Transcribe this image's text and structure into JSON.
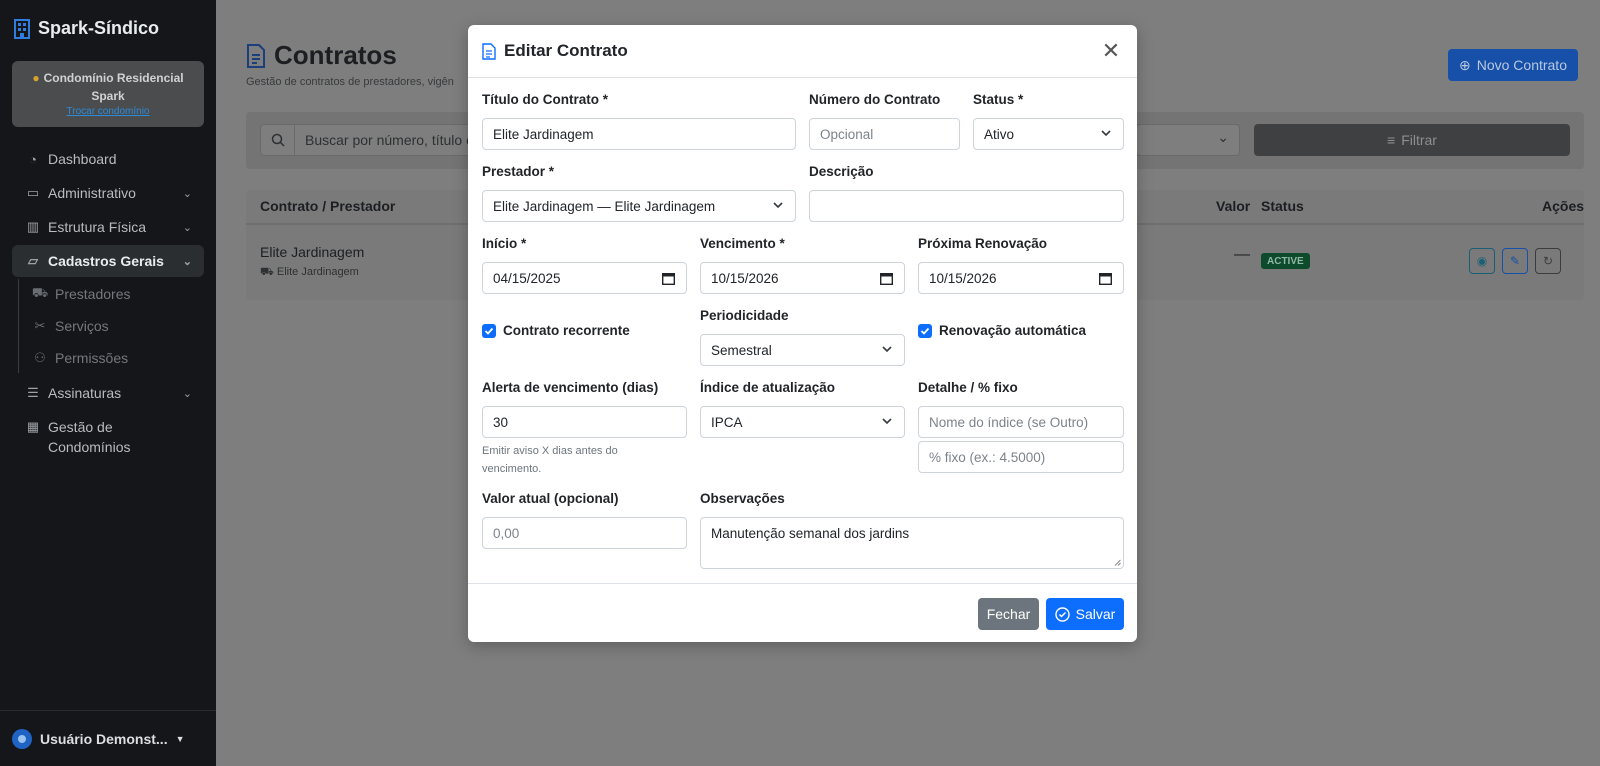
{
  "app": {
    "name": "Spark-Síndico"
  },
  "condo": {
    "name": "Condomínio Residencial Spark",
    "switch_label": "Trocar condomínio"
  },
  "nav": {
    "dashboard": "Dashboard",
    "administrativo": "Administrativo",
    "estrutura": "Estrutura Física",
    "cadastros": "Cadastros Gerais",
    "sub": {
      "prestadores": "Prestadores",
      "servicos": "Serviços",
      "permissoes": "Permissões"
    },
    "assinaturas": "Assinaturas",
    "gestao": "Gestão de Condomínios"
  },
  "user": {
    "name": "Usuário Demonst..."
  },
  "page": {
    "title": "Contratos",
    "subtitle": "Gestão de contratos de prestadores, vigên",
    "new_button": "Novo Contrato",
    "search_placeholder": "Buscar por número, título o",
    "filter_button": "Filtrar",
    "table": {
      "headers": {
        "contract": "Contrato / Prestador",
        "value": "Valor",
        "status": "Status",
        "actions": "Ações"
      },
      "rows": [
        {
          "title": "Elite Jardinagem",
          "provider": "Elite Jardinagem",
          "value": "—",
          "status": "ACTIVE"
        }
      ]
    }
  },
  "modal": {
    "title": "Editar Contrato",
    "fields": {
      "titulo": {
        "label": "Título do Contrato *",
        "value": "Elite Jardinagem"
      },
      "numero": {
        "label": "Número do Contrato",
        "placeholder": "Opcional"
      },
      "status": {
        "label": "Status *",
        "value": "Ativo"
      },
      "prestador": {
        "label": "Prestador *",
        "value": "Elite Jardinagem — Elite Jardinagem"
      },
      "descricao": {
        "label": "Descrição",
        "value": ""
      },
      "inicio": {
        "label": "Início *",
        "value": "04/15/2025"
      },
      "vencimento": {
        "label": "Vencimento *",
        "value": "10/15/2026"
      },
      "renovacao": {
        "label": "Próxima Renovação",
        "value": "10/15/2026"
      },
      "recorrente": {
        "label": "Contrato recorrente",
        "checked": true
      },
      "periodicidade": {
        "label": "Periodicidade",
        "value": "Semestral"
      },
      "renov_auto": {
        "label": "Renovação automática",
        "checked": true
      },
      "alerta": {
        "label": "Alerta de vencimento (dias)",
        "value": "30",
        "help1": "Emitir aviso X dias antes do",
        "help2": "vencimento."
      },
      "indice": {
        "label": "Índice de atualização",
        "value": "IPCA"
      },
      "detalhe": {
        "label": "Detalhe / % fixo",
        "placeholder_nome": "Nome do índice (se Outro)",
        "placeholder_fixo": "% fixo (ex.: 4.5000)"
      },
      "valor": {
        "label": "Valor atual (opcional)",
        "placeholder": "0,00"
      },
      "observacoes": {
        "label": "Observações",
        "value": "Manutenção semanal dos jardins"
      }
    },
    "close_button": "Fechar",
    "save_button": "Salvar"
  },
  "colors": {
    "primary": "#0d6efd",
    "secondary": "#6c757d",
    "sidebar": "#141619",
    "success_badge": "#0e4a2c"
  }
}
